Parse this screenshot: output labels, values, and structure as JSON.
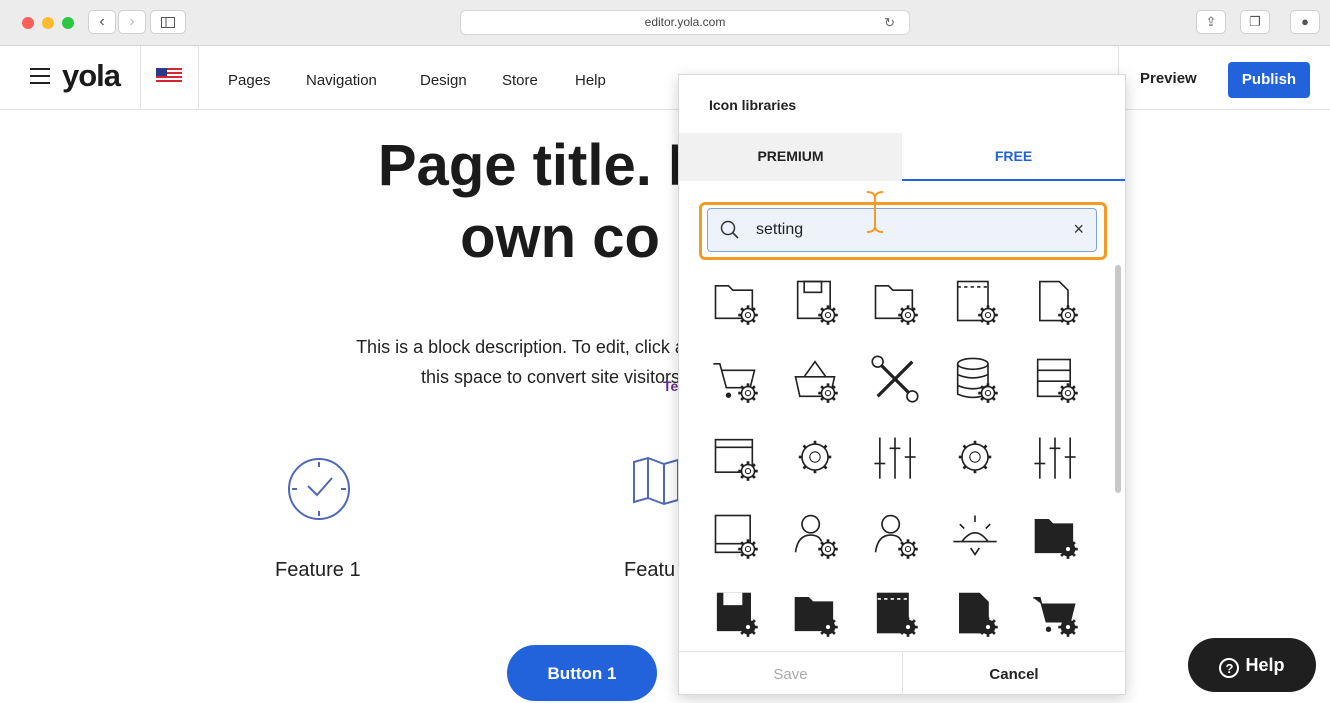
{
  "browser": {
    "url": "editor.yola.com",
    "icons": [
      "back-icon",
      "forward-icon",
      "sidebar-icon",
      "reload-icon",
      "share-icon",
      "tabs-icon",
      "download-icon"
    ]
  },
  "header": {
    "logo": "yola",
    "menu": [
      "Pages",
      "Navigation",
      "Design",
      "Store",
      "Help"
    ],
    "preview": "Preview",
    "publish": "Publish"
  },
  "canvas": {
    "title_line1": "Page title. Re",
    "title_line2": "own co",
    "description_line1": "This is a block description. To edit, click and type t",
    "description_line2": "this space to convert site visitors i",
    "text_tag": "Text",
    "features": [
      {
        "label": "Feature 1",
        "icon": "clock-icon"
      },
      {
        "label": "Featu",
        "icon": "map-icon"
      }
    ],
    "button1": "Button 1"
  },
  "icon_panel": {
    "title": "Icon libraries",
    "tabs": [
      "PREMIUM",
      "FREE"
    ],
    "active_tab": "FREE",
    "search_value": "setting",
    "clear": "×",
    "save": "Save",
    "cancel": "Cancel",
    "icons": [
      "folder-gear-icon",
      "floppy-gear-icon",
      "folder-gear-icon",
      "document-gear-icon",
      "file-gear-icon",
      "cart-gear-icon",
      "basket-gear-icon",
      "wrench-screwdriver-icon",
      "database-gear-icon",
      "server-gear-icon",
      "browser-gear-icon",
      "gear-icon",
      "sliders-icon",
      "gear-icon",
      "sliders-icon",
      "screen-gear-icon",
      "user-gear-icon",
      "user-gear-icon",
      "sun-icon",
      "folder-gear-filled-icon",
      "floppy-gear-filled-icon",
      "folder-gear-filled-icon",
      "document-gear-filled-icon",
      "file-gear-filled-icon",
      "cart-gear-filled-icon"
    ]
  },
  "help": {
    "label": "Help"
  },
  "colors": {
    "accent": "#2263db",
    "highlight": "#f59a23",
    "help_bg": "#1f1f1f"
  }
}
